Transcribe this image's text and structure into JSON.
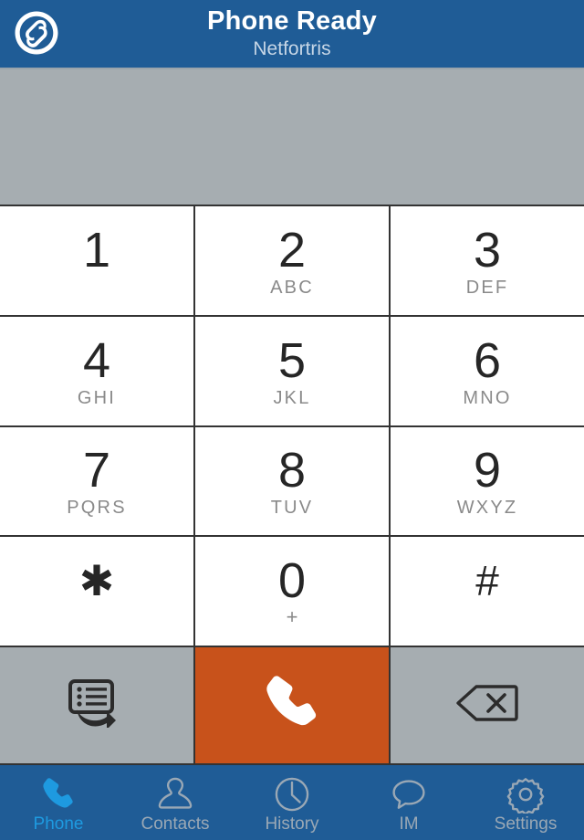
{
  "header": {
    "title": "Phone Ready",
    "subtitle": "Netfortris",
    "logo_icon": "netfortris-logo-icon",
    "background_color": "#1f5c96",
    "title_color": "#ffffff",
    "subtitle_color": "#c6d6e6"
  },
  "display": {
    "number": "",
    "placeholder": "",
    "background_color": "#a6adb1"
  },
  "keypad": {
    "keys": [
      {
        "digit": "1",
        "letters": "",
        "name": "key-1"
      },
      {
        "digit": "2",
        "letters": "ABC",
        "name": "key-2"
      },
      {
        "digit": "3",
        "letters": "DEF",
        "name": "key-3"
      },
      {
        "digit": "4",
        "letters": "GHI",
        "name": "key-4"
      },
      {
        "digit": "5",
        "letters": "JKL",
        "name": "key-5"
      },
      {
        "digit": "6",
        "letters": "MNO",
        "name": "key-6"
      },
      {
        "digit": "7",
        "letters": "PQRS",
        "name": "key-7"
      },
      {
        "digit": "8",
        "letters": "TUV",
        "name": "key-8"
      },
      {
        "digit": "9",
        "letters": "WXYZ",
        "name": "key-9"
      },
      {
        "digit": "✱",
        "letters": "",
        "name": "key-star"
      },
      {
        "digit": "0",
        "letters": "+",
        "name": "key-0"
      },
      {
        "digit": "#",
        "letters": "",
        "name": "key-pound"
      }
    ],
    "key_background": "#ffffff",
    "digit_color": "#262626",
    "letters_color": "#8a8a8a"
  },
  "actions": {
    "redial_icon": "call-log-redial-icon",
    "call_icon": "phone-handset-icon",
    "backspace_icon": "backspace-delete-icon",
    "call_button_color": "#c8521b",
    "action_background": "#a6adb1"
  },
  "tabbar": {
    "active_color": "#1e9ae0",
    "inactive_color": "#9aa8b5",
    "background_color": "#1f5c96",
    "tabs": [
      {
        "label": "Phone",
        "icon": "phone-handset-icon",
        "name": "tab-phone",
        "active": true
      },
      {
        "label": "Contacts",
        "icon": "person-icon",
        "name": "tab-contacts",
        "active": false
      },
      {
        "label": "History",
        "icon": "clock-icon",
        "name": "tab-history",
        "active": false
      },
      {
        "label": "IM",
        "icon": "chat-bubble-icon",
        "name": "tab-im",
        "active": false
      },
      {
        "label": "Settings",
        "icon": "gear-icon",
        "name": "tab-settings",
        "active": false
      }
    ]
  }
}
